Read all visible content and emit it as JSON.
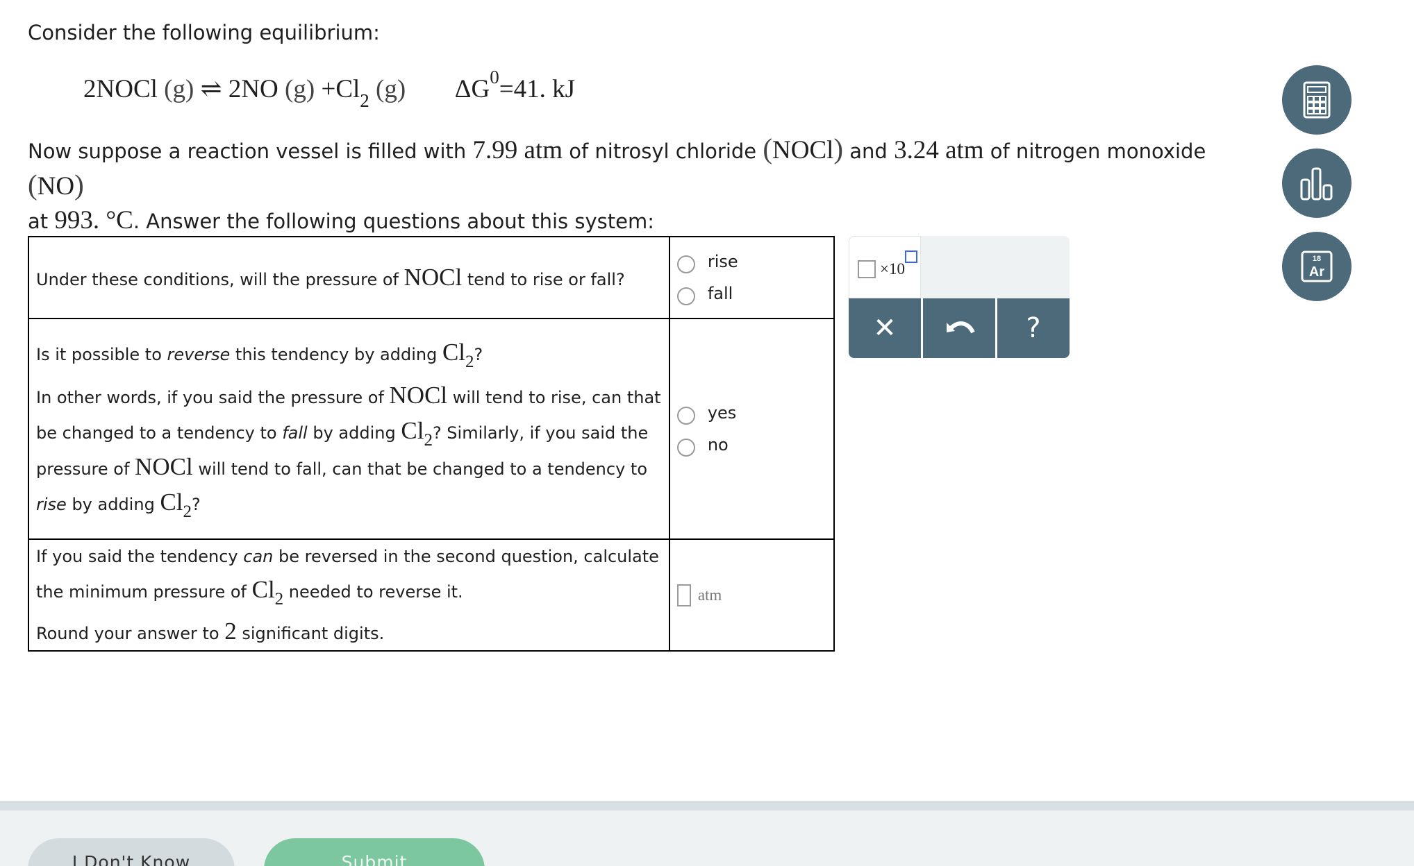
{
  "intro_text": "Consider the following equilibrium:",
  "equation": {
    "reactant": "2NOCl",
    "reactant_phase": "(g)",
    "arrow": "⇌",
    "product1": "2NO",
    "product1_phase": "(g)",
    "plus": "+",
    "product2": "Cl",
    "product2_sub": "2",
    "product2_phase": "(g)",
    "dg_symbol": "ΔG",
    "dg_sup": "0",
    "dg_value": "=41. kJ"
  },
  "conditions": {
    "t1": "Now suppose a reaction vessel is filled with ",
    "nocl_pressure": "7.99 atm",
    "t2": " of nitrosyl chloride ",
    "nocl_formula": "NOCl",
    "t3": " and ",
    "no_pressure": "3.24 atm",
    "t4": " of nitrogen monoxide ",
    "no_formula": "NO",
    "t5": "at ",
    "temperature": "993. °C",
    "t6": ". Answer the following questions about this system:"
  },
  "questions": {
    "q1": {
      "t1": "Under these conditions, will the pressure of ",
      "f1": "NOCl",
      "t2": " tend to rise or fall?",
      "opt1": "rise",
      "opt2": "fall"
    },
    "q2": {
      "l1a": "Is it possible to ",
      "l1em": "reverse",
      "l1b": " this tendency by adding ",
      "l1f": "Cl",
      "l1sub": "2",
      "l1q": "?",
      "p2a": "In other words, if you said the pressure of ",
      "p2f1": "NOCl",
      "p2b": " will tend to rise, can that be changed to a tendency to ",
      "p2em1": "fall",
      "p2c": " by adding ",
      "p2f2": "Cl",
      "p2sub": "2",
      "p2d": "? Similarly, if you said the pressure of ",
      "p2f3": "NOCl",
      "p2e": " will tend to fall, can that be changed to a tendency to ",
      "p2em2": "rise",
      "p2f": " by adding ",
      "p2f4": "Cl",
      "p2sub2": "2",
      "p2g": "?",
      "opt1": "yes",
      "opt2": "no"
    },
    "q3": {
      "a1": "If you said the tendency ",
      "aem": "can",
      "a2": " be reversed in the second question, calculate the minimum pressure of ",
      "af": "Cl",
      "asub": "2",
      "a3": " needed to reverse it.",
      "b1": "Round your answer to ",
      "bnum": "2",
      "b2": " significant digits.",
      "unit": "atm"
    }
  },
  "tools": {
    "x10_label": "×10",
    "clear_symbol": "✕",
    "help_symbol": "?"
  },
  "sidebar": {
    "periodic_number": "18",
    "periodic_symbol": "Ar"
  },
  "footer": {
    "dont_know": "I Don't Know",
    "submit": "Submit"
  },
  "colors": {
    "tool_bg": "#4d6a7b",
    "submit_bg": "#7cc79f",
    "exponent_box": "#3b66e8"
  }
}
